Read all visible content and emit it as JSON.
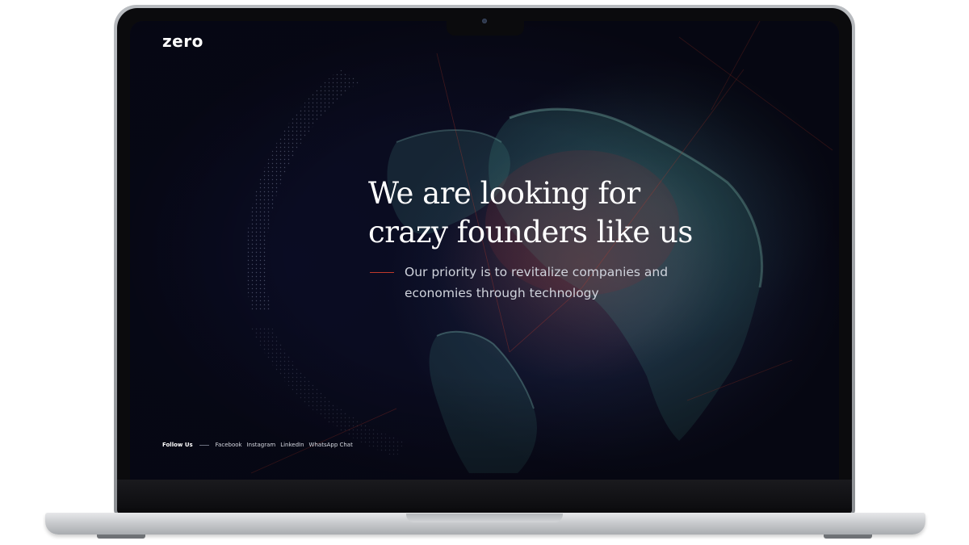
{
  "site": {
    "logo": "zero"
  },
  "hero": {
    "headline_line1": "We are looking for",
    "headline_line2": "crazy founders like us",
    "subline_line1": "Our priority is to revitalize companies and",
    "subline_line2": "economies through technology"
  },
  "social": {
    "label": "Follow Us",
    "links": [
      "Facebook",
      "Instagram",
      "LinkedIn",
      "WhatsApp Chat"
    ]
  },
  "colors": {
    "background": "#0a0b1c",
    "accent": "#c0392b",
    "text": "#ffffff",
    "subtext": "#cfd3dc",
    "laptop_silver": "#c9cbce"
  }
}
